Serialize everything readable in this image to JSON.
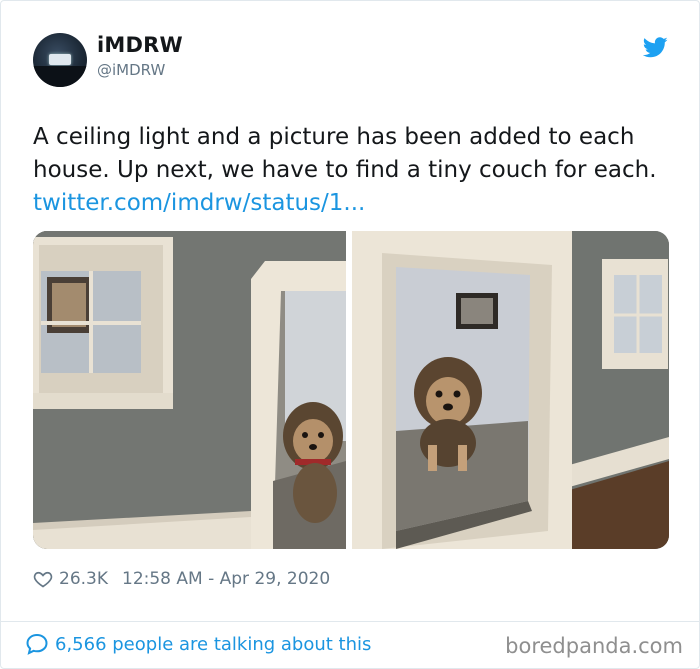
{
  "author": {
    "display_name": "iMDRW",
    "handle": "@iMDRW"
  },
  "tweet": {
    "text": "A ceiling light and a picture has been added to each house. Up next, we have to find a tiny couch for each.",
    "link": "twitter.com/imdrw/status/1..."
  },
  "photos": [
    {
      "id": "left",
      "alt_icon": "photo"
    },
    {
      "id": "right",
      "alt_icon": "photo"
    }
  ],
  "meta": {
    "likes": "26.3K",
    "timestamp": "12:58 AM - Apr 29, 2020"
  },
  "footer": {
    "talking": "6,566 people are talking about this",
    "watermark": "boredpanda.com"
  },
  "colors": {
    "link": "#1b95e0",
    "muted": "#657786",
    "twitter_blue": "#1da1f2"
  }
}
